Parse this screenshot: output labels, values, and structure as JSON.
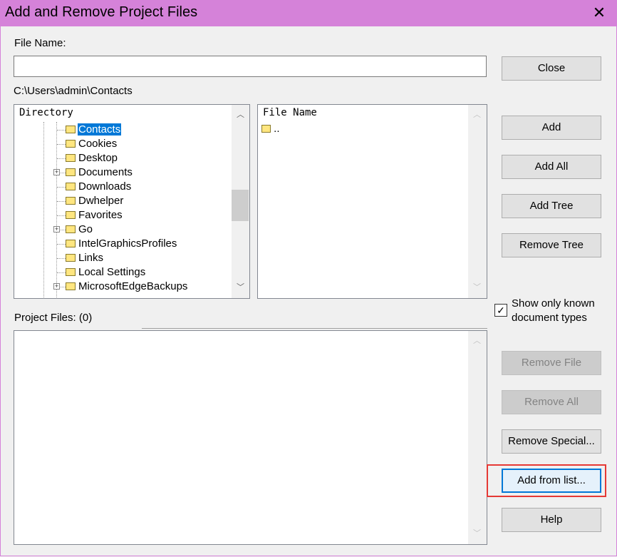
{
  "window": {
    "title": "Add and Remove Project Files",
    "close_glyph": "✕"
  },
  "file_name": {
    "label": "File Name:",
    "value": ""
  },
  "current_path": "C:\\Users\\admin\\Contacts",
  "directory_tree": {
    "header": "Directory",
    "items": [
      {
        "label": "Contacts",
        "expandable": false,
        "selected": true
      },
      {
        "label": "Cookies",
        "expandable": false,
        "selected": false
      },
      {
        "label": "Desktop",
        "expandable": false,
        "selected": false
      },
      {
        "label": "Documents",
        "expandable": true,
        "selected": false
      },
      {
        "label": "Downloads",
        "expandable": false,
        "selected": false
      },
      {
        "label": "Dwhelper",
        "expandable": false,
        "selected": false
      },
      {
        "label": "Favorites",
        "expandable": false,
        "selected": false
      },
      {
        "label": "Go",
        "expandable": true,
        "selected": false
      },
      {
        "label": "IntelGraphicsProfiles",
        "expandable": false,
        "selected": false
      },
      {
        "label": "Links",
        "expandable": false,
        "selected": false
      },
      {
        "label": "Local Settings",
        "expandable": false,
        "selected": false
      },
      {
        "label": "MicrosoftEdgeBackups",
        "expandable": true,
        "selected": false
      }
    ]
  },
  "file_list": {
    "header": "File Name",
    "items": [
      {
        "label": "..",
        "icon": "folder-up-icon"
      }
    ]
  },
  "project_files": {
    "label": "Project Files: (0)",
    "items": []
  },
  "options": {
    "show_known_types_label_line1": "Show only known",
    "show_known_types_label_line2": "document types",
    "show_known_types_checked": true,
    "check_glyph": "✓"
  },
  "buttons": {
    "close": "Close",
    "add": "Add",
    "add_all": "Add All",
    "add_tree": "Add Tree",
    "remove_tree": "Remove Tree",
    "remove_file": "Remove File",
    "remove_all": "Remove All",
    "remove_special": "Remove Special...",
    "add_from_list": "Add from list...",
    "help": "Help"
  },
  "glyphs": {
    "scroll_up": "︿",
    "scroll_down": "﹀",
    "expander": "+"
  },
  "colors": {
    "titlebar": "#d582d9",
    "selection": "#0078d7",
    "highlight_box": "#e53935"
  }
}
